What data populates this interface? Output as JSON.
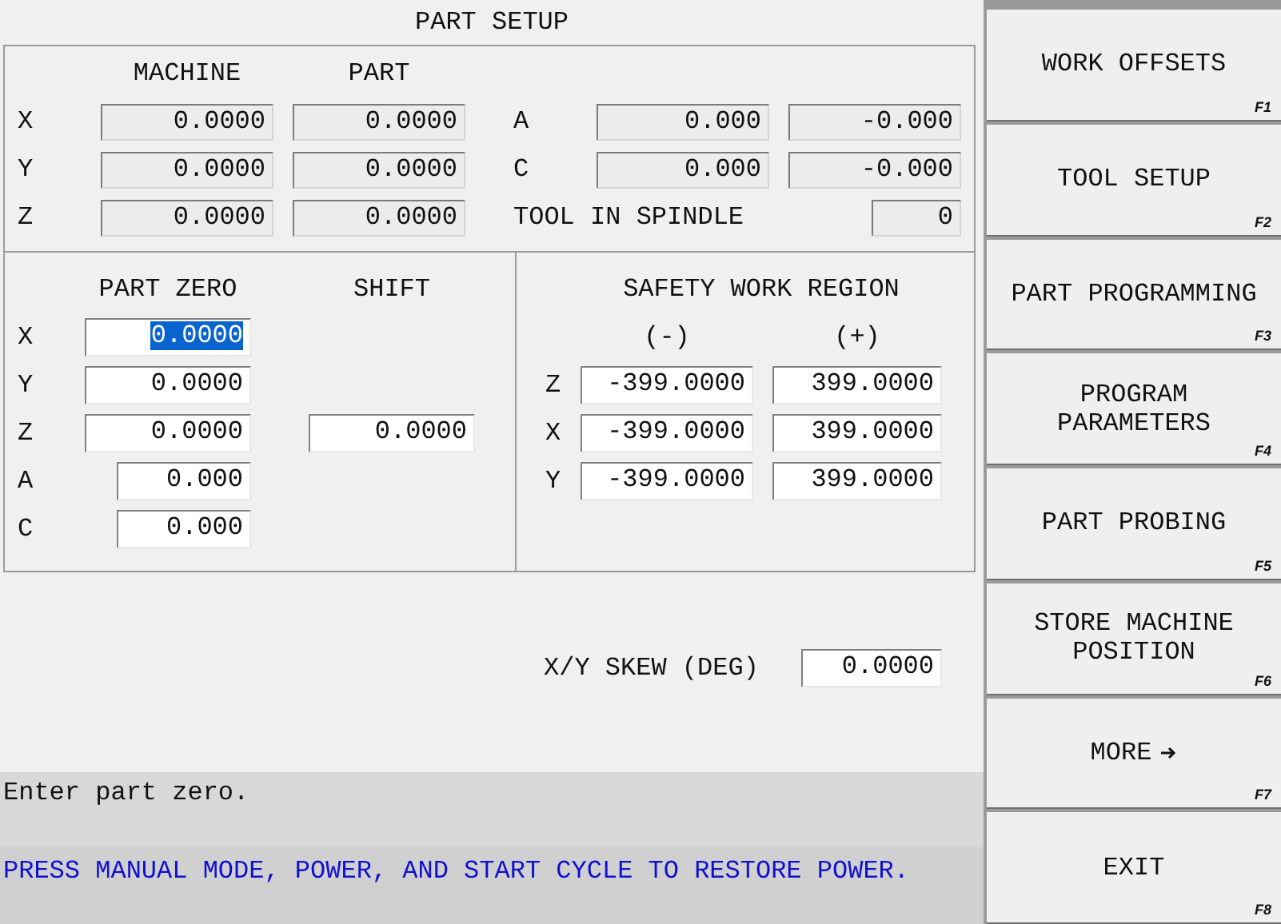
{
  "title": "PART SETUP",
  "position": {
    "columns": [
      "MACHINE",
      "PART"
    ],
    "rows": [
      {
        "axis": "X",
        "machine": "0.0000",
        "part": "0.0000"
      },
      {
        "axis": "Y",
        "machine": "0.0000",
        "part": "0.0000"
      },
      {
        "axis": "Z",
        "machine": "0.0000",
        "part": "0.0000"
      }
    ]
  },
  "rotary": {
    "rows": [
      {
        "axis": "A",
        "machine": "0.000",
        "part": "-0.000"
      },
      {
        "axis": "C",
        "machine": "0.000",
        "part": "-0.000"
      }
    ],
    "tool_in_spindle": {
      "label": "TOOL IN SPINDLE",
      "value": "0"
    }
  },
  "part_zero": {
    "columns": [
      "PART ZERO",
      "SHIFT"
    ],
    "rows": [
      {
        "axis": "X",
        "kind": "linear",
        "value": "0.0000",
        "selected": true
      },
      {
        "axis": "Y",
        "kind": "linear",
        "value": "0.0000",
        "selected": false
      },
      {
        "axis": "Z",
        "kind": "linear",
        "value": "0.0000",
        "selected": false,
        "shift": {
          "value": "0.0000",
          "selected": false
        }
      },
      {
        "axis": "A",
        "kind": "rotary",
        "value": "0.000",
        "selected": false
      },
      {
        "axis": "C",
        "kind": "rotary",
        "value": "0.000",
        "selected": false
      }
    ]
  },
  "safety": {
    "title": "SAFETY WORK REGION",
    "columns": [
      "(-)",
      "(+)"
    ],
    "rows": [
      {
        "axis": "Z",
        "min": "-399.0000",
        "max": "399.0000"
      },
      {
        "axis": "X",
        "min": "-399.0000",
        "max": "399.0000"
      },
      {
        "axis": "Y",
        "min": "-399.0000",
        "max": "399.0000"
      }
    ]
  },
  "skew": {
    "label": "X/Y SKEW (DEG)",
    "value": "0.0000"
  },
  "message": "Enter part zero.",
  "notice": "PRESS MANUAL MODE, POWER, AND START CYCLE TO RESTORE POWER.",
  "softkeys": [
    {
      "lines": [
        "WORK OFFSETS"
      ],
      "key": "F1",
      "arrow": false
    },
    {
      "lines": [
        "TOOL SETUP"
      ],
      "key": "F2",
      "arrow": false
    },
    {
      "lines": [
        "PART PROGRAMMING"
      ],
      "key": "F3",
      "arrow": false
    },
    {
      "lines": [
        "PROGRAM",
        "PARAMETERS"
      ],
      "key": "F4",
      "arrow": false
    },
    {
      "lines": [
        "PART PROBING"
      ],
      "key": "F5",
      "arrow": false
    },
    {
      "lines": [
        "STORE MACHINE",
        "POSITION"
      ],
      "key": "F6",
      "arrow": false
    },
    {
      "lines": [
        "MORE"
      ],
      "key": "F7",
      "arrow": true
    },
    {
      "lines": [
        "EXIT"
      ],
      "key": "F8",
      "arrow": false
    }
  ]
}
